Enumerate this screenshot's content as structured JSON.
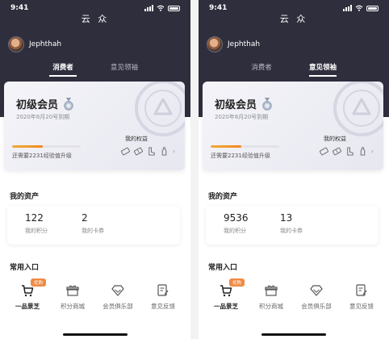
{
  "status_bar": {
    "time": "9:41"
  },
  "app_title": "云 众",
  "username": "Jephthah",
  "tabs": [
    "消费者",
    "意见领袖"
  ],
  "member_card": {
    "level": "初级会员",
    "expiry": "2020年6月20号到期",
    "benefits_label": "我的权益",
    "benefit_icons": [
      "ticket-icon",
      "coupon-icon",
      "boot-icon",
      "bottle-icon"
    ],
    "upgrade_text": "还需要2231经验值升级",
    "progress": 0.45
  },
  "assets_title": "我的资产",
  "assets_labels": {
    "points": "我的积分",
    "coupons": "我的卡券"
  },
  "entries_title": "常用入口",
  "entries": [
    {
      "label": "一品景芝",
      "icon": "cart-icon",
      "badge": "优购"
    },
    {
      "label": "积分商城",
      "icon": "gift-icon"
    },
    {
      "label": "会员俱乐部",
      "icon": "diamond-icon"
    },
    {
      "label": "意见反馈",
      "icon": "feedback-icon"
    }
  ],
  "screens": [
    {
      "active_tab": 0,
      "points": "122",
      "coupons": "2"
    },
    {
      "active_tab": 1,
      "points": "9536",
      "coupons": "13"
    }
  ],
  "colors": {
    "header": "#2f2e3d",
    "accent": "#f28a1e",
    "badge": "#f08a45"
  }
}
